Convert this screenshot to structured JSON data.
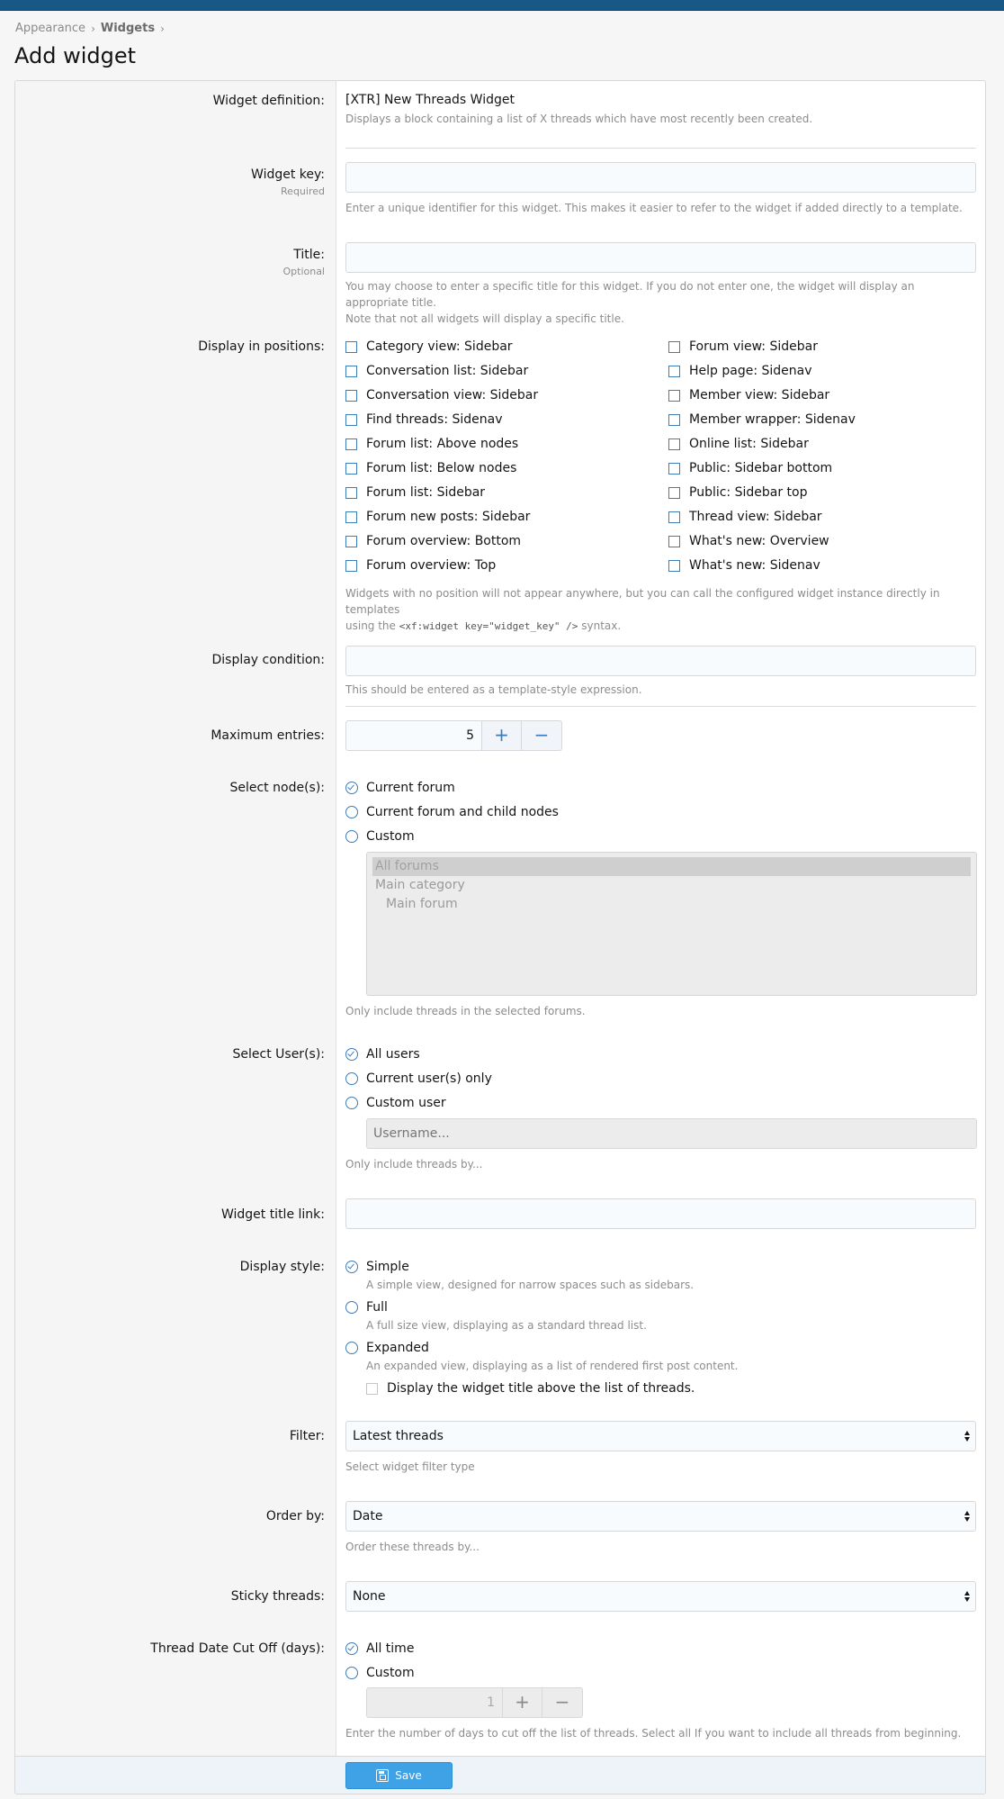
{
  "breadcrumb": [
    "Appearance",
    "Widgets"
  ],
  "page_title": "Add widget",
  "widget_definition": {
    "label": "Widget definition:",
    "value": "[XTR] New Threads Widget",
    "description": "Displays a block containing a list of X threads which have most recently been created."
  },
  "widget_key": {
    "label": "Widget key:",
    "sublabel": "Required",
    "value": "",
    "hint": "Enter a unique identifier for this widget. This makes it easier to refer to the widget if added directly to a template."
  },
  "title_field": {
    "label": "Title:",
    "sublabel": "Optional",
    "value": "",
    "hint_line1": "You may choose to enter a specific title for this widget. If you do not enter one, the widget will display an appropriate title.",
    "hint_line2": "Note that not all widgets will display a specific title."
  },
  "positions": {
    "label": "Display in positions:",
    "left": [
      "Category view: Sidebar",
      "Conversation list: Sidebar",
      "Conversation view: Sidebar",
      "Find threads: Sidenav",
      "Forum list: Above nodes",
      "Forum list: Below nodes",
      "Forum list: Sidebar",
      "Forum new posts: Sidebar",
      "Forum overview: Bottom",
      "Forum overview: Top"
    ],
    "right": [
      "Forum view: Sidebar",
      "Help page: Sidenav",
      "Member view: Sidebar",
      "Member wrapper: Sidenav",
      "Online list: Sidebar",
      "Public: Sidebar bottom",
      "Public: Sidebar top",
      "Thread view: Sidebar",
      "What's new: Overview",
      "What's new: Sidenav"
    ],
    "hint_line1": "Widgets with no position will not appear anywhere, but you can call the configured widget instance directly in templates",
    "hint_line2_pre": "using the ",
    "hint_code": "<xf:widget key=\"widget_key\" />",
    "hint_line2_post": " syntax."
  },
  "display_condition": {
    "label": "Display condition:",
    "value": "",
    "hint": "This should be entered as a template-style expression."
  },
  "max_entries": {
    "label": "Maximum entries:",
    "value": "5",
    "plus": "+",
    "minus": "−"
  },
  "select_nodes": {
    "label": "Select node(s):",
    "options": [
      "Current forum",
      "Current forum and child nodes",
      "Custom"
    ],
    "selected_index": 0,
    "list": [
      "All forums",
      "Main category",
      "Main forum"
    ],
    "hint": "Only include threads in the selected forums."
  },
  "select_users": {
    "label": "Select User(s):",
    "options": [
      "All users",
      "Current user(s) only",
      "Custom user"
    ],
    "selected_index": 0,
    "placeholder": "Username...",
    "hint": "Only include threads by..."
  },
  "title_link": {
    "label": "Widget title link:",
    "value": ""
  },
  "display_style": {
    "label": "Display style:",
    "options": [
      {
        "title": "Simple",
        "desc": "A simple view, designed for narrow spaces such as sidebars."
      },
      {
        "title": "Full",
        "desc": "A full size view, displaying as a standard thread list."
      },
      {
        "title": "Expanded",
        "desc": "An expanded view, displaying as a list of rendered first post content."
      }
    ],
    "selected_index": 0,
    "sub_checkbox": "Display the widget title above the list of threads."
  },
  "filter": {
    "label": "Filter:",
    "value": "Latest threads",
    "hint": "Select widget filter type"
  },
  "order_by": {
    "label": "Order by:",
    "value": "Date",
    "hint": "Order these threads by..."
  },
  "sticky": {
    "label": "Sticky threads:",
    "value": "None"
  },
  "cutoff": {
    "label": "Thread Date Cut Off (days):",
    "options": [
      "All time",
      "Custom"
    ],
    "selected_index": 0,
    "value": "1",
    "plus": "+",
    "minus": "−",
    "hint": "Enter the number of days to cut off the list of threads. Select all If you want to include all threads from beginning."
  },
  "save_label": "Save",
  "colors": {
    "header": "#185886",
    "accent": "#3c7cb7",
    "button": "#3fa2e6"
  }
}
